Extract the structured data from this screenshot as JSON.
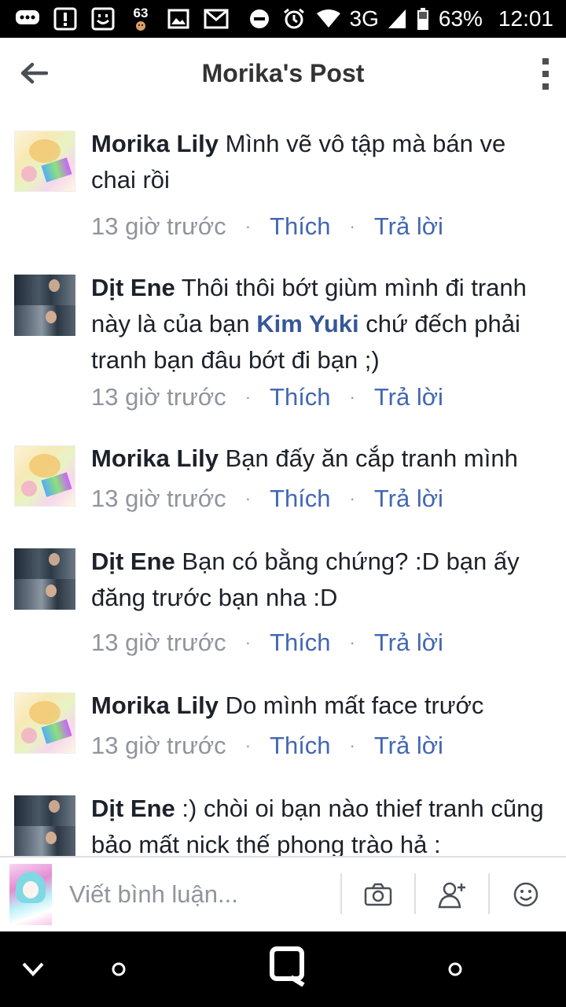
{
  "status_bar": {
    "notification_badge": "63",
    "network": "3G",
    "battery": "63%",
    "time": "12:01"
  },
  "header": {
    "title": "Morika's Post"
  },
  "actions": {
    "like": "Thích",
    "reply": "Trả lời",
    "separator": "·"
  },
  "comments": [
    {
      "author": "Morika Lily",
      "text": "Mình vẽ vô tập mà bán ve chai rồi",
      "time": "13 giờ trước"
    },
    {
      "author": "Dịt Ene",
      "text_before": "Thôi thôi bớt giùm mình đi tranh này là của bạn",
      "mention": "Kim Yuki",
      "text_after": "chứ đếch phải tranh bạn đâu bớt đi bạn ;)",
      "time": "13 giờ trước"
    },
    {
      "author": "Morika Lily",
      "text": "Bạn đấy ăn cắp tranh mình",
      "time": "13 giờ trước"
    },
    {
      "author": "Dịt Ene",
      "text": "Bạn có bằng chứng?  :D bạn ấy đăng trước bạn nha :D",
      "time": "13 giờ trước"
    },
    {
      "author": "Morika Lily",
      "text": "Do mình mất face trước",
      "time": "13 giờ trước"
    },
    {
      "author": "Dịt Ene",
      "text": ":) chòi oi bạn nào thief tranh cũng bảo mất nick thế phong trào hả :"
    }
  ],
  "composer": {
    "placeholder": "Viết bình luận..."
  },
  "icons": {
    "status_bar": [
      "chat-bubble-icon",
      "alert-icon",
      "smiley-icon",
      "facebook-badge-icon",
      "image-icon",
      "gmail-icon",
      "do-not-disturb-icon",
      "alarm-icon",
      "wifi-icon",
      "signal-icon",
      "battery-icon"
    ],
    "header": [
      "back-arrow-icon",
      "more-vertical-icon"
    ],
    "composer": [
      "camera-icon",
      "tag-person-icon",
      "emoji-icon"
    ],
    "nav": [
      "chevron-down-icon",
      "circle-icon",
      "app-switch-icon",
      "circle-icon"
    ]
  }
}
